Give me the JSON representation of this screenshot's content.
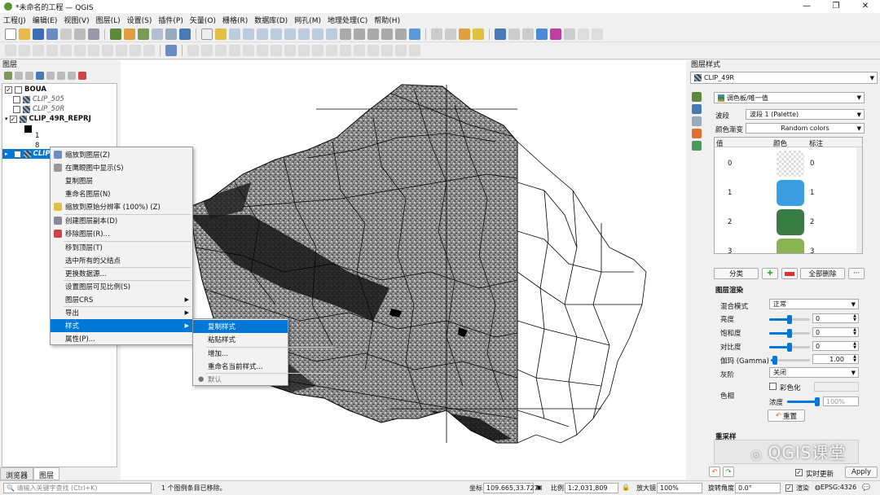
{
  "window": {
    "title": "*未命名的工程 — QGIS",
    "controls": [
      "—",
      "❐",
      "✕"
    ]
  },
  "menu": [
    "工程(J)",
    "编辑(E)",
    "视图(V)",
    "图层(L)",
    "设置(S)",
    "插件(P)",
    "矢量(O)",
    "栅格(R)",
    "数据库(D)",
    "网孔(M)",
    "地理处理(C)",
    "帮助(H)"
  ],
  "layers_panel": {
    "title": "图层",
    "items": [
      {
        "name": "BOUA",
        "checked": true,
        "style": "bold"
      },
      {
        "name": "CLIP_505",
        "checked": false,
        "style": "ital"
      },
      {
        "name": "CLIP_50R",
        "checked": false,
        "style": "ital"
      },
      {
        "name": "CLIP_49R_REPRJ",
        "checked": true,
        "style": "bold"
      },
      {
        "legend": "1"
      },
      {
        "legend": "8"
      },
      {
        "name": "CLIP_49R",
        "checked": false,
        "style": "sel"
      }
    ]
  },
  "context_menu": {
    "items": [
      "缩放到图层(Z)",
      "在鹰眼图中显示(S)",
      "复制图层",
      "重命名图层(N)",
      "缩放到原始分辨率 (100%) (Z)",
      "创建图层副本(D)",
      "移除图层(R)...",
      "移到顶层(T)",
      "选中所有的父结点",
      "更换数据源...",
      "设置图层可见比例(S)",
      "图层CRS",
      "导出",
      "样式",
      "属性(P)..."
    ],
    "submenu": [
      "复制样式",
      "粘贴样式",
      "增加...",
      "重命名当前样式...",
      "默认"
    ]
  },
  "bottom_tabs": [
    "浏览器",
    "图层"
  ],
  "style_panel": {
    "title": "图层样式",
    "layer": "CLIP_49R",
    "renderer": "调色板/唯一值",
    "band_label": "波段",
    "band_value": "波段 1 (Palette)",
    "ramp_label": "颜色渐变",
    "ramp_value": "Random colors",
    "headers": [
      "值",
      "颜色",
      "标注"
    ],
    "rows": [
      {
        "value": "0",
        "color": "transparent",
        "label": "0"
      },
      {
        "value": "1",
        "color": "#3b9ee0",
        "label": "1"
      },
      {
        "value": "2",
        "color": "#3a7d44",
        "label": "2"
      },
      {
        "value": "3",
        "color": "#8ab352",
        "label": "3"
      }
    ],
    "classify_btn": "分类",
    "delete_all_btn": "全部删除",
    "more_btn": "···",
    "render_section": "图层渲染",
    "blend_label": "混合模式",
    "blend_value": "正常",
    "brightness_label": "亮度",
    "brightness_value": "0",
    "saturation_label": "饱和度",
    "saturation_value": "0",
    "contrast_label": "对比度",
    "contrast_value": "0",
    "gamma_label": "伽玛 (Gamma)",
    "gamma_value": "1.00",
    "grayscale_label": "灰阶",
    "grayscale_value": "关闭",
    "hue_label": "色相",
    "colorize_label": "彩色化",
    "strength_label": "浓度",
    "strength_value": "100%",
    "reset_btn": "重置",
    "resample_label": "重采样",
    "live_update": "实时更新",
    "apply_btn": "Apply"
  },
  "status": {
    "search_placeholder": "请输入关键字查找 (Ctrl+K)",
    "message": "1 个图例条目已移除。",
    "coord_label": "坐标",
    "coord_value": "109.665,33.727",
    "scale_label": "比例",
    "scale_value": "1:2,031,809",
    "magnifier_label": "放大镜",
    "magnifier_value": "100%",
    "rotation_label": "旋转角度",
    "rotation_value": "0.0°",
    "render_label": "渲染",
    "crs": "EPSG:4326"
  },
  "watermark": "QGIS课堂",
  "colors": {
    "accent": "#0078d7",
    "selection": "#0078d7"
  }
}
